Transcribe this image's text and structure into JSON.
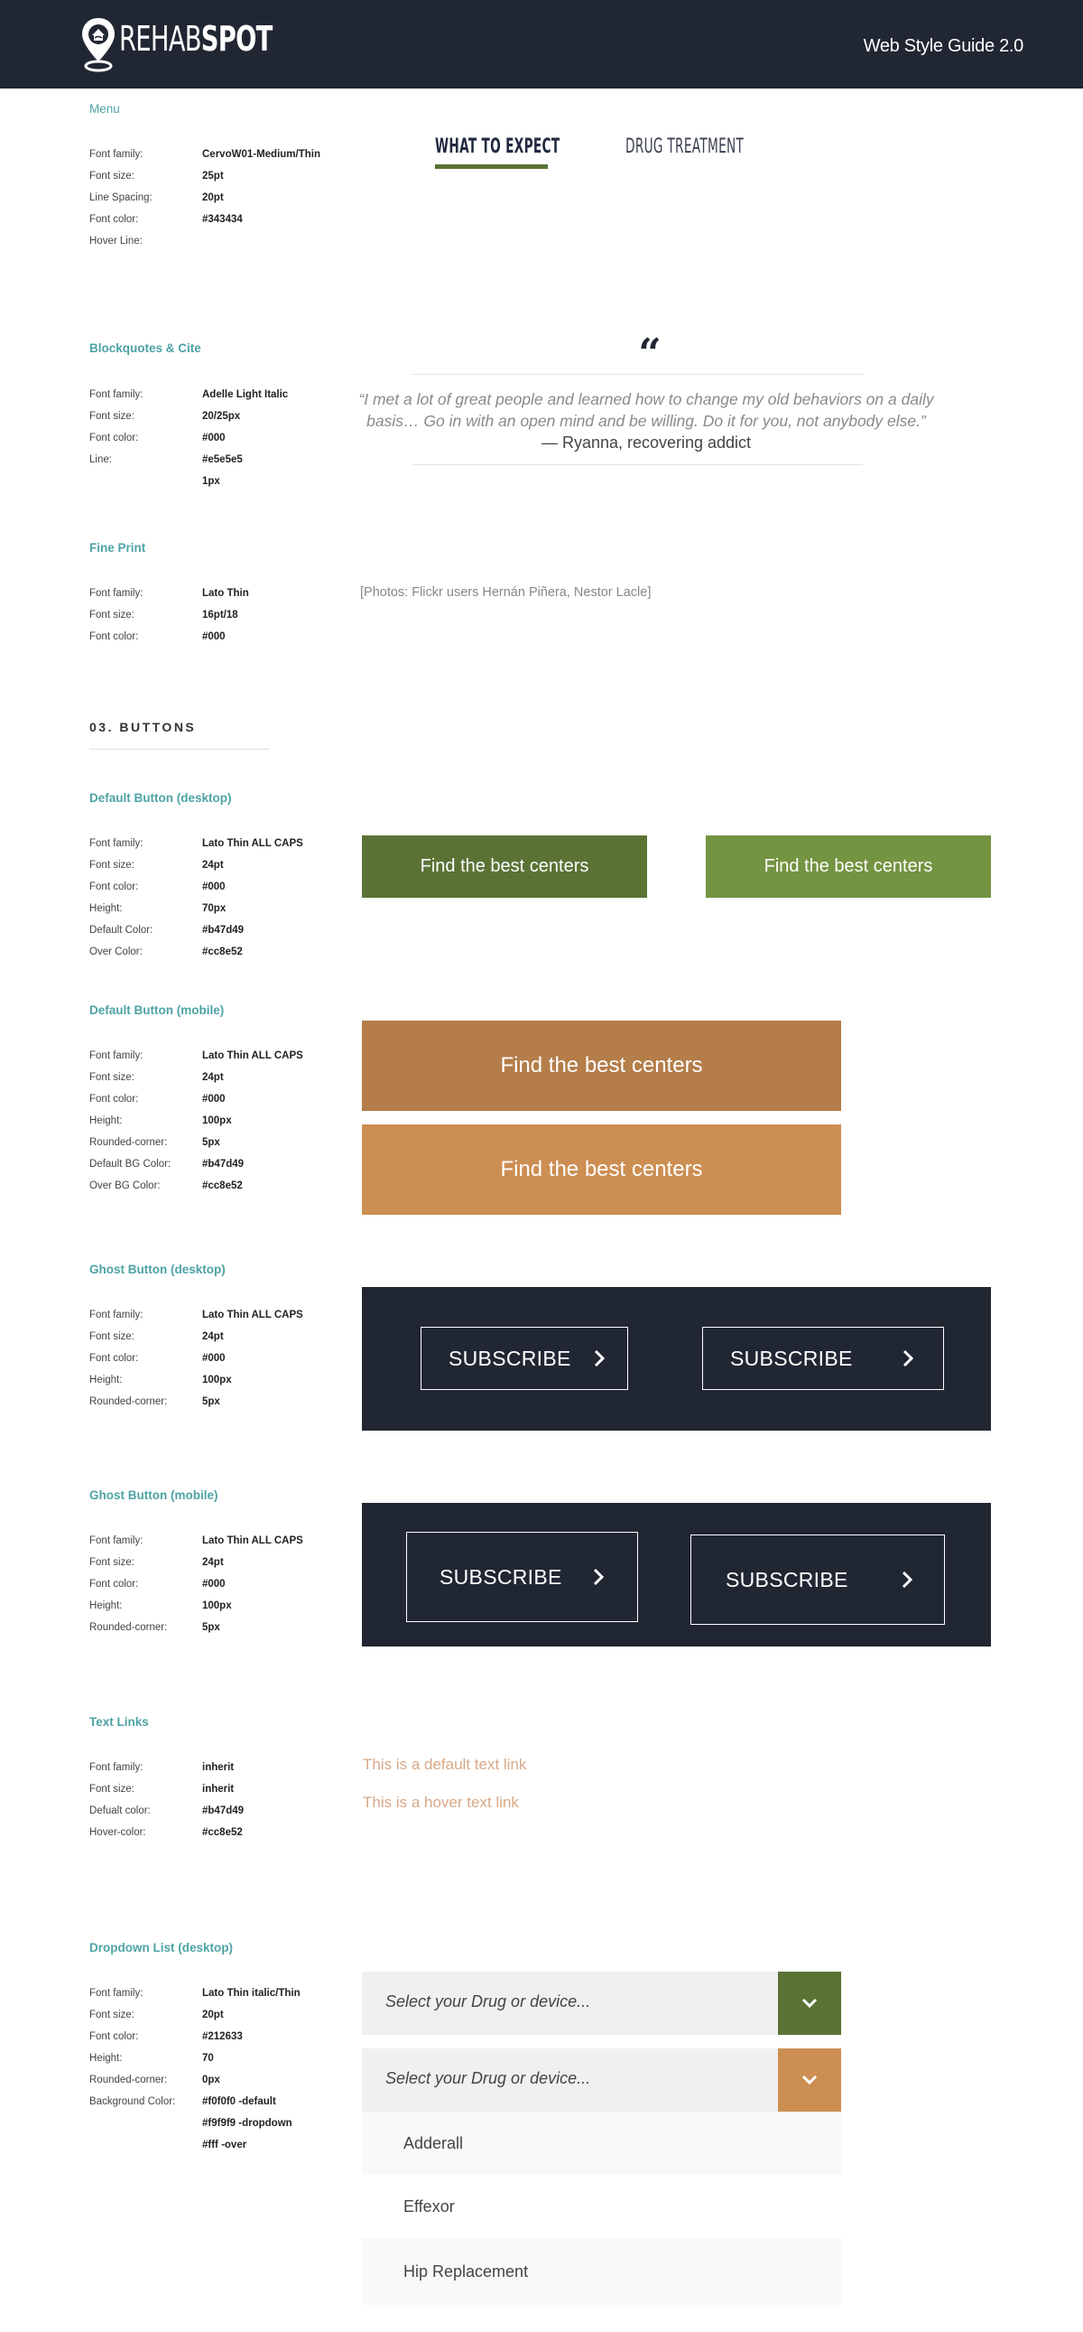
{
  "header": {
    "logo_thin": "REHAB",
    "logo_bold": "SPOT",
    "title": "Web Style Guide 2.0",
    "background": "#212633"
  },
  "sections": {
    "menu": {
      "title": "Menu",
      "specs": [
        {
          "label": "Font family:",
          "value": "CervoW01-Medium/Thin"
        },
        {
          "label": "Font size:",
          "value": "25pt"
        },
        {
          "label": "Line Spacing:",
          "value": "20pt"
        },
        {
          "label": "Font color:",
          "value": "#343434"
        },
        {
          "label": "Hover Line:",
          "value": ""
        }
      ],
      "demo": {
        "active_item": "WHAT TO EXPECT",
        "inactive_item": "DRUG TREATMENT",
        "hover_line_color": "#5a7335"
      }
    },
    "blockquote": {
      "title": "Blockquotes & Cite",
      "specs": [
        {
          "label": "Font family:",
          "value": "Adelle Light Italic"
        },
        {
          "label": "Font size:",
          "value": "20/25px"
        },
        {
          "label": "Font color:",
          "value": "#000"
        },
        {
          "label": "Line:",
          "value": "#e5e5e5"
        },
        {
          "label": "",
          "value": "1px"
        }
      ],
      "demo": {
        "quote_glyph": "“",
        "quote": "“I met a lot of great people and learned how to change my old behaviors on a daily basis… Go in with an open mind and be willing. Do it for you, not anybody else.”",
        "cite": " — Ryanna, recovering addict"
      }
    },
    "fine_print": {
      "title": "Fine Print",
      "specs": [
        {
          "label": "Font family:",
          "value": "Lato Thin"
        },
        {
          "label": "Font size:",
          "value": "16pt/18"
        },
        {
          "label": "Font color:",
          "value": "#000"
        }
      ],
      "demo": "[Photos: Flickr users Hernán Piñera, Nestor Lacle]"
    },
    "buttons_heading": "03. BUTTONS",
    "default_desktop": {
      "title": "Default Button (desktop)",
      "specs": [
        {
          "label": "Font family:",
          "value": "Lato Thin ALL CAPS"
        },
        {
          "label": "Font size:",
          "value": "24pt"
        },
        {
          "label": "Font color:",
          "value": "#000"
        },
        {
          "label": "Height:",
          "value": "70px"
        },
        {
          "label": "Default Color:",
          "value": "#b47d49"
        },
        {
          "label": "Over Color:",
          "value": "#cc8e52"
        }
      ],
      "demo": {
        "label": "Find the best centers",
        "default_bg": "#5a7335",
        "over_bg": "#739441"
      }
    },
    "default_mobile": {
      "title": "Default Button (mobile)",
      "specs": [
        {
          "label": "Font family:",
          "value": "Lato Thin ALL CAPS"
        },
        {
          "label": "Font size:",
          "value": "24pt"
        },
        {
          "label": "Font color:",
          "value": "#000"
        },
        {
          "label": "Height:",
          "value": "100px"
        },
        {
          "label": "Rounded-corner:",
          "value": "5px"
        },
        {
          "label": "Default BG Color:",
          "value": "#b47d49"
        },
        {
          "label": "Over BG Color:",
          "value": "#cc8e52"
        }
      ],
      "demo": {
        "label": "Find the best centers",
        "default_bg": "#b47d49",
        "over_bg": "#cc8e52"
      }
    },
    "ghost_desktop": {
      "title": "Ghost Button (desktop)",
      "specs": [
        {
          "label": "Font family:",
          "value": "Lato Thin ALL CAPS"
        },
        {
          "label": "Font size:",
          "value": "24pt"
        },
        {
          "label": "Font color:",
          "value": "#000"
        },
        {
          "label": "Height:",
          "value": "100px"
        },
        {
          "label": "Rounded-corner:",
          "value": "5px"
        }
      ],
      "demo": {
        "label": "SUBSCRIBE",
        "icon": "chevron-right-icon"
      }
    },
    "ghost_mobile": {
      "title": "Ghost Button (mobile)",
      "specs": [
        {
          "label": "Font family:",
          "value": "Lato Thin ALL CAPS"
        },
        {
          "label": "Font size:",
          "value": "24pt"
        },
        {
          "label": "Font color:",
          "value": "#000"
        },
        {
          "label": "Height:",
          "value": "100px"
        },
        {
          "label": "Rounded-corner:",
          "value": "5px"
        }
      ],
      "demo": {
        "label": "SUBSCRIBE",
        "icon": "chevron-right-icon"
      }
    },
    "text_links": {
      "title": "Text Links",
      "specs": [
        {
          "label": "Font family:",
          "value": "inherit"
        },
        {
          "label": "Font size:",
          "value": "inherit"
        },
        {
          "label": "Defualt color:",
          "value": "#b47d49"
        },
        {
          "label": "Hover-color:",
          "value": "#cc8e52"
        }
      ],
      "demo": {
        "default_link": "This is a default text link",
        "hover_link": "This is a hover text link"
      }
    },
    "dropdown": {
      "title": "Dropdown List (desktop)",
      "specs": [
        {
          "label": "Font family:",
          "value": "Lato Thin italic/Thin"
        },
        {
          "label": "Font size:",
          "value": "20pt"
        },
        {
          "label": "Font color:",
          "value": "#212633"
        },
        {
          "label": "Height:",
          "value": "70"
        },
        {
          "label": "Rounded-corner:",
          "value": "0px"
        },
        {
          "label": "Background Color:",
          "value": "#f0f0f0 -default"
        },
        {
          "label": "",
          "value": "#f9f9f9 -dropdown"
        },
        {
          "label": "",
          "value": "#fff -over"
        }
      ],
      "demo": {
        "placeholder": "Select your Drug or device...",
        "default_arrow_bg": "#5a7335",
        "open_arrow_bg": "#cc8e52",
        "options": [
          "Adderall",
          "Effexor",
          "Hip Replacement"
        ]
      }
    }
  }
}
